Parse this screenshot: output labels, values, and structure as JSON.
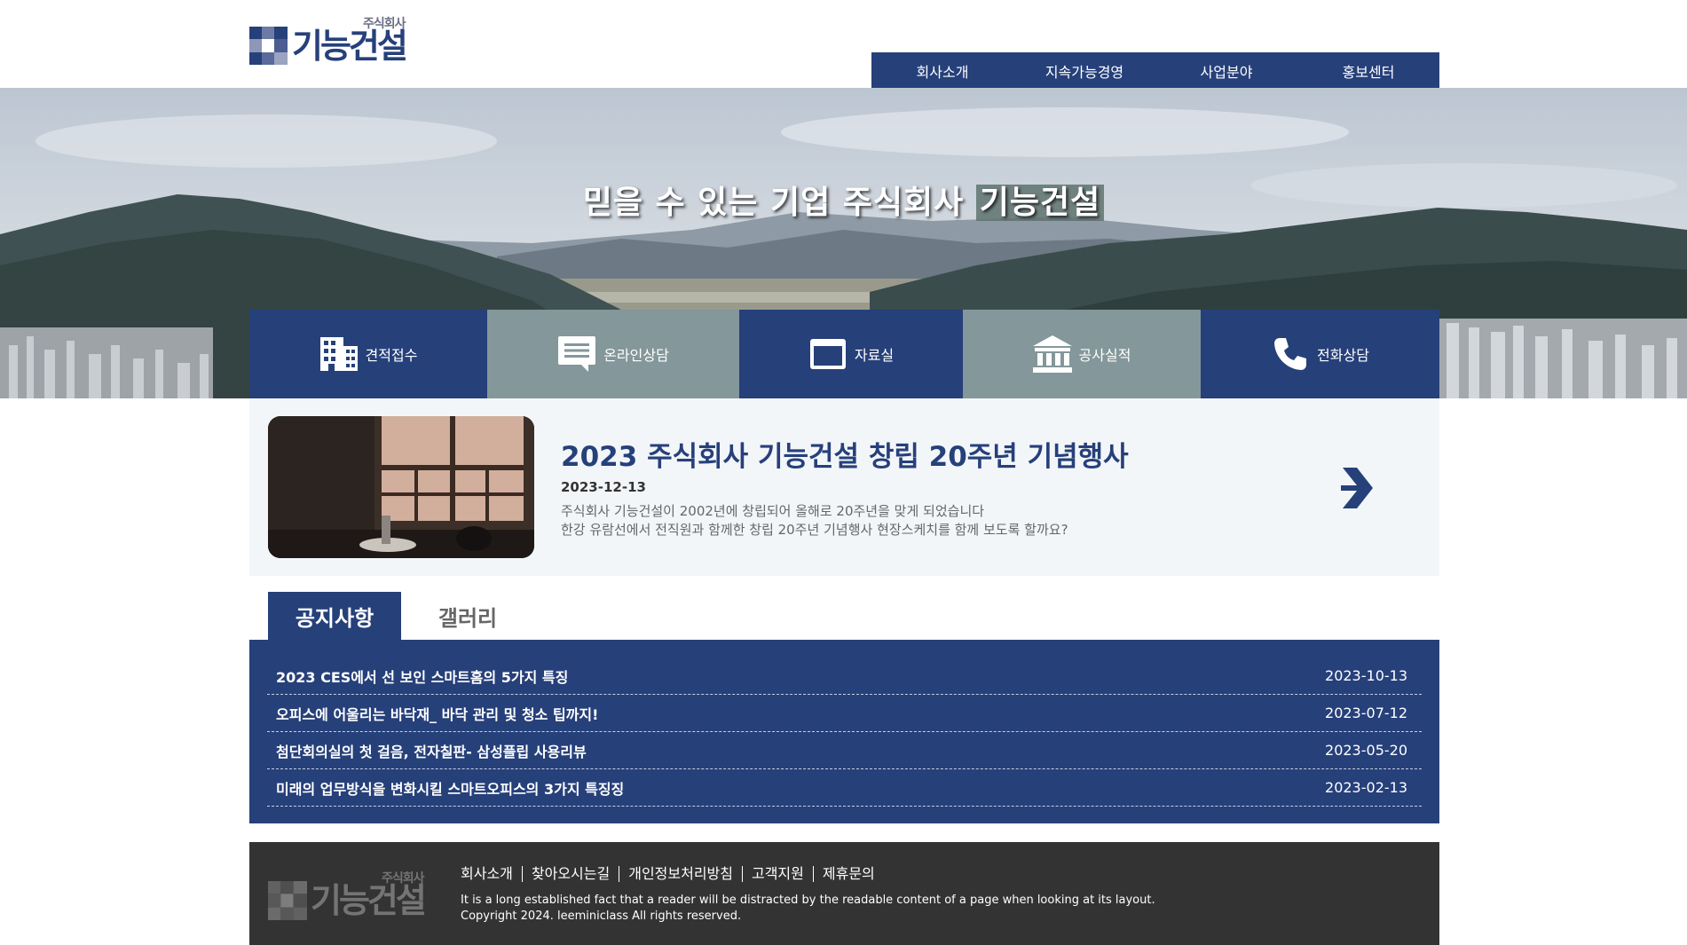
{
  "logo": {
    "sub": "주식회사",
    "main": "기능건설"
  },
  "nav": [
    "회사소개",
    "지속가능경영",
    "사업분야",
    "홍보센터"
  ],
  "hero": {
    "title_pre": "믿을 수 있는 기업 주식회사 ",
    "title_highlight": "기능건설"
  },
  "quick": [
    {
      "label": "견적접수",
      "icon": "building-icon"
    },
    {
      "label": "온라인상담",
      "icon": "chat-icon"
    },
    {
      "label": "자료실",
      "icon": "folder-icon"
    },
    {
      "label": "공사실적",
      "icon": "bank-icon"
    },
    {
      "label": "전화상담",
      "icon": "phone-icon"
    }
  ],
  "news": {
    "title": "2023 주식회사 기능건설 창립 20주년 기념행사",
    "date": "2023-12-13",
    "desc1": "주식회사 기능건설이 2002년에 창립되어 올해로 20주년을 맞게 되었습니다",
    "desc2": "한강 유람선에서 전직원과 함께한 창립 20주년 기념행사 현장스케치를 함께 보도록 할까요?"
  },
  "tabs": {
    "notice": "공지사항",
    "gallery": "갤러리"
  },
  "board": [
    {
      "title": "2023 CES에서 선 보인 스마트홈의 5가지 특징",
      "date": "2023-10-13"
    },
    {
      "title": "오피스에 어울리는 바닥재_ 바닥 관리 및 청소 팁까지!",
      "date": "2023-07-12"
    },
    {
      "title": "첨단회의실의 첫 걸음, 전자칠판- 삼성플립 사용리뷰",
      "date": "2023-05-20"
    },
    {
      "title": "미래의 업무방식을 변화시킬 스마트오피스의 3가지 특징징",
      "date": "2023-02-13"
    }
  ],
  "footer": {
    "links": [
      "회사소개",
      "찾아오시는길",
      "개인정보처리방침",
      "고객지원",
      "제휴문의"
    ],
    "line1": "It is a long established fact that a reader will be distracted by the readable content of a page when looking at its layout.",
    "line2": "Copyright 2024. leeminiclass All rights reserved."
  },
  "colors": {
    "navy": "#26407a",
    "gray": "#84979a",
    "footer": "#333333"
  }
}
